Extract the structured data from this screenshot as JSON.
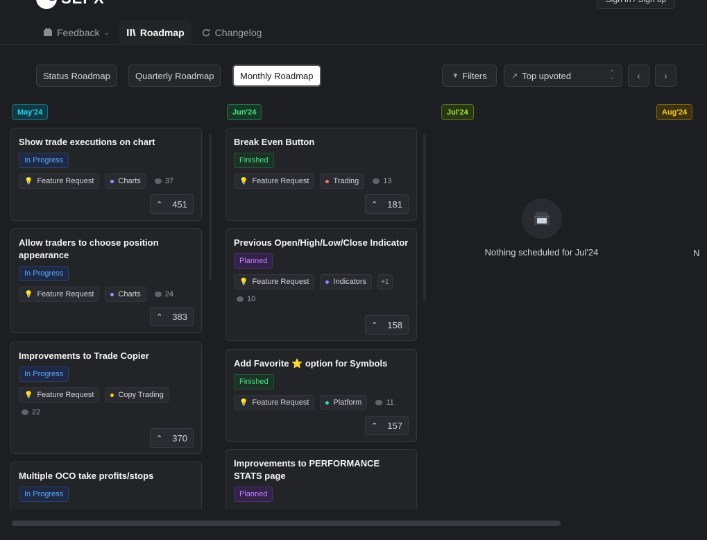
{
  "app": {
    "logo_text": "SEPX",
    "signin_label": "Sign in / Sign up"
  },
  "nav": {
    "tabs": [
      {
        "label": "Feedback",
        "icon": "inbox-icon"
      },
      {
        "label": "Roadmap",
        "icon": "roadmap-icon",
        "active": true
      },
      {
        "label": "Changelog",
        "icon": "refresh-icon"
      }
    ]
  },
  "toolbar": {
    "views": [
      "Status Roadmap",
      "Quarterly Roadmap",
      "Monthly Roadmap"
    ],
    "active_view": "Monthly Roadmap",
    "filters_label": "Filters",
    "sort_label": "Top upvoted"
  },
  "months": [
    {
      "label": "May'24",
      "color": "#22d3ee",
      "bg": "#133a44"
    },
    {
      "label": "Jun'24",
      "color": "#4ade80",
      "bg": "#173a27"
    },
    {
      "label": "Jul'24",
      "color": "#a3e635",
      "bg": "#2a3614"
    },
    {
      "label": "Aug'24",
      "color": "#facc15",
      "bg": "#3d3213"
    }
  ],
  "columns": [
    {
      "cards": [
        {
          "title": "Show trade executions on chart",
          "status": "In Progress",
          "status_type": "progress",
          "tags": [
            {
              "label": "Feature Request",
              "kind": "bulb"
            },
            {
              "label": "Charts",
              "color": "#a78bfa"
            }
          ],
          "comments": "37",
          "votes": "451"
        },
        {
          "title": "Allow traders to choose position appearance",
          "status": "In Progress",
          "status_type": "progress",
          "tags": [
            {
              "label": "Feature Request",
              "kind": "bulb"
            },
            {
              "label": "Charts",
              "color": "#a78bfa"
            }
          ],
          "comments": "24",
          "votes": "383"
        },
        {
          "title": "Improvements to Trade Copier",
          "status": "In Progress",
          "status_type": "progress",
          "tags": [
            {
              "label": "Feature Request",
              "kind": "bulb"
            },
            {
              "label": "Copy Trading",
              "color": "#facc15"
            }
          ],
          "comments": "22",
          "votes": "370"
        },
        {
          "title": "Multiple OCO take profits/stops",
          "status": "In Progress",
          "status_type": "progress",
          "tags": [],
          "comments": "",
          "votes": ""
        }
      ]
    },
    {
      "cards": [
        {
          "title": "Break Even Button",
          "status": "Finished",
          "status_type": "finished",
          "tags": [
            {
              "label": "Feature Request",
              "kind": "bulb"
            },
            {
              "label": "Trading",
              "color": "#f87171"
            }
          ],
          "comments": "13",
          "votes": "181"
        },
        {
          "title": "Previous Open/High/Low/Close Indicator",
          "status": "Planned",
          "status_type": "planned",
          "tags": [
            {
              "label": "Feature Request",
              "kind": "bulb"
            },
            {
              "label": "Indicators",
              "color": "#818cf8"
            }
          ],
          "more": "+1",
          "comments": "10",
          "votes": "158"
        },
        {
          "title": "Add Favorite ⭐ option for Symbols",
          "status": "Finished",
          "status_type": "finished",
          "tags": [
            {
              "label": "Feature Request",
              "kind": "bulb"
            },
            {
              "label": "Platform",
              "color": "#2dd4bf"
            }
          ],
          "comments": "11",
          "votes": "157"
        },
        {
          "title": "Improvements to PERFORMANCE STATS page",
          "status": "Planned",
          "status_type": "planned",
          "tags": [],
          "comments": "",
          "votes": ""
        }
      ]
    }
  ],
  "empty": {
    "text": "Nothing scheduled for Jul'24",
    "clipped_next": "N"
  }
}
